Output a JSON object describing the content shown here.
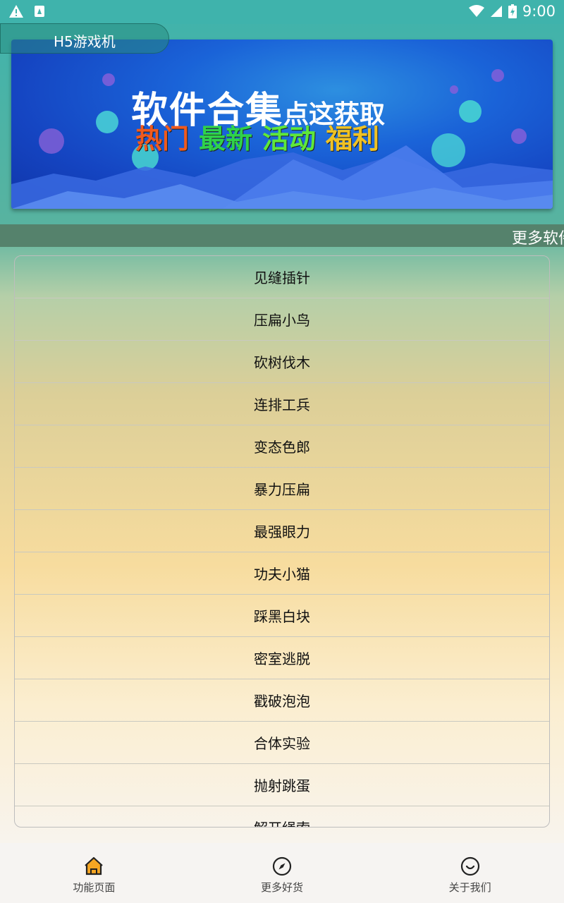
{
  "app": {
    "title": "H5游戏机"
  },
  "status_bar": {
    "time": "9:00"
  },
  "banner": {
    "title_big": "软件合集",
    "title_small": "点这获取",
    "tags": [
      {
        "label": "热门",
        "color": "#f05a1e"
      },
      {
        "label": "最新",
        "color": "#2fd24a"
      },
      {
        "label": "活动",
        "color": "#5ee83a"
      },
      {
        "label": "福利",
        "color": "#f0c224"
      }
    ]
  },
  "marquee": {
    "text": "更多软件"
  },
  "games": [
    "见缝插针",
    "压扁小鸟",
    "砍树伐木",
    "连排工兵",
    "变态色郎",
    "暴力压扁",
    "最强眼力",
    "功夫小猫",
    "踩黑白块",
    "密室逃脱",
    "戳破泡泡",
    "合体实验",
    "抛射跳蛋",
    "解开绳索"
  ],
  "nav": [
    {
      "label": "功能页面",
      "icon": "home-icon",
      "active_color": "#f5a623"
    },
    {
      "label": "更多好货",
      "icon": "compass-icon"
    },
    {
      "label": "关于我们",
      "icon": "smile-icon"
    }
  ]
}
